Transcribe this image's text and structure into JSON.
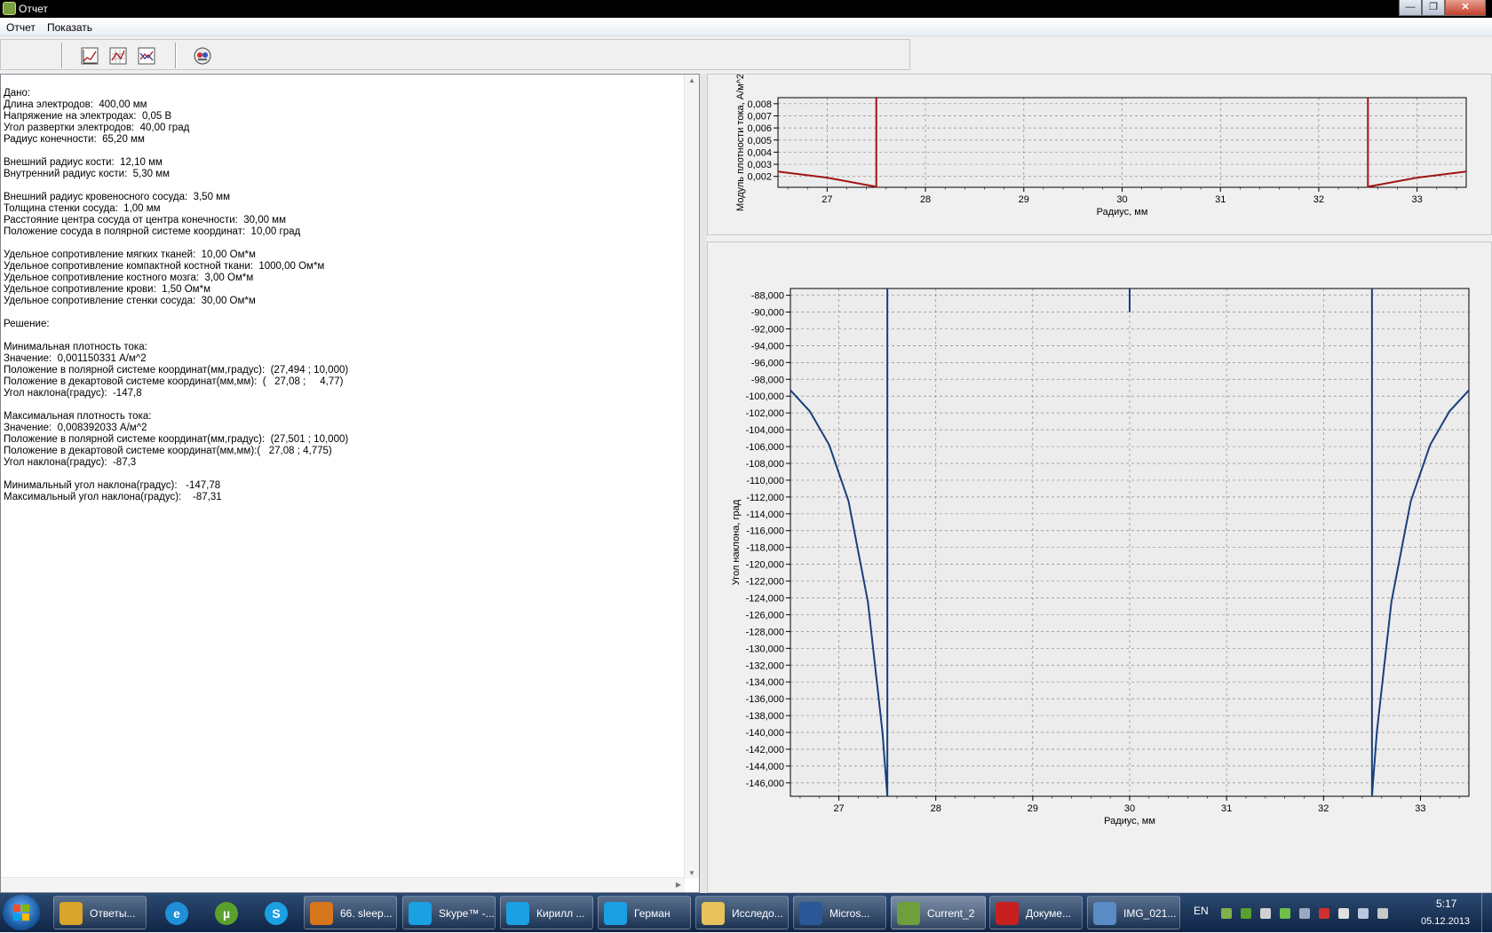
{
  "window": {
    "title": "Отчет",
    "buttons": [
      "—",
      "❐",
      "✕"
    ]
  },
  "menu": [
    "Отчет",
    "Показать"
  ],
  "report_lines": [
    "Дано:",
    "Длина электродов:  400,00 мм",
    "Напряжение на электродах:  0,05 В",
    "Угол развертки электродов:  40,00 град",
    "Радиус конечности:  65,20 мм",
    "",
    "Внешний радиус кости:  12,10 мм",
    "Внутренний радиус кости:  5,30 мм",
    "",
    "Внешний радиус кровеносного сосуда:  3,50 мм",
    "Толщина стенки сосуда:  1,00 мм",
    "Расстояние центра сосуда от центра конечности:  30,00 мм",
    "Положение сосуда в полярной системе координат:  10,00 град",
    "",
    "Удельное сопротивление мягких тканей:  10,00 Ом*м",
    "Удельное сопротивление компактной костной ткани:  1000,00 Ом*м",
    "Удельное сопротивление костного мозга:  3,00 Ом*м",
    "Удельное сопротивление крови:  1,50 Ом*м",
    "Удельное сопротивление стенки сосуда:  30,00 Ом*м",
    "",
    "Решение:",
    "",
    "Минимальная плотность тока:",
    "Значение:  0,001150331 А/м^2",
    "Положение в полярной системе координат(мм,градус):  (27,494 ; 10,000)",
    "Положение в декартовой системе координат(мм,мм):  (   27,08 ;     4,77)",
    "Угол наклона(градус):  -147,8",
    "",
    "Максимальная плотность тока:",
    "Значение:  0,008392033 А/м^2",
    "Положение в полярной системе координат(мм,градус):  (27,501 ; 10,000)",
    "Положение в декартовой системе координат(мм,мм):(   27,08 ; 4,775)",
    "Угол наклона(градус):  -87,3",
    "",
    "Минимальный угол наклона(градус):   -147,78",
    "Максимальный угол наклона(градус):    -87,31"
  ],
  "chart_data": [
    {
      "type": "line",
      "xlabel": "Радиус, мм",
      "ylabel": "Модуль плотности тока, А/м^2",
      "xlim": [
        26.5,
        33.5
      ],
      "ylim": [
        0.0011,
        0.0085
      ],
      "x_ticks": [
        "27",
        "28",
        "29",
        "30",
        "31",
        "32",
        "33"
      ],
      "y_ticks": [
        "0,008",
        "0,007",
        "0,006",
        "0,005",
        "0,004",
        "0,003",
        "0,002"
      ],
      "y_tick_values": [
        0.008,
        0.007,
        0.006,
        0.005,
        0.004,
        0.003,
        0.002
      ],
      "grid": true,
      "color": "#a01414",
      "series": [
        {
          "x": [
            26.5,
            27.0,
            27.5,
            27.5001,
            27.5001,
            27.5
          ],
          "y": [
            0.0024,
            0.0019,
            0.00115,
            0.00115,
            0.0085,
            0.0085
          ]
        },
        {
          "x": [
            32.5,
            32.5,
            32.5001,
            32.5001,
            33.0,
            33.5
          ],
          "y": [
            0.0085,
            0.00115,
            0.00115,
            0.00115,
            0.0019,
            0.0024
          ]
        }
      ]
    },
    {
      "type": "line",
      "xlabel": "Радиус, мм",
      "ylabel": "Угол наклона, град",
      "xlim": [
        26.5,
        33.5
      ],
      "ylim": [
        -147.6,
        -87.2
      ],
      "x_ticks": [
        "27",
        "28",
        "29",
        "30",
        "31",
        "32",
        "33"
      ],
      "y_ticks": [
        "-88,000",
        "-90,000",
        "-92,000",
        "-94,000",
        "-96,000",
        "-98,000",
        "-100,000",
        "-102,000",
        "-104,000",
        "-106,000",
        "-108,000",
        "-110,000",
        "-112,000",
        "-114,000",
        "-116,000",
        "-118,000",
        "-120,000",
        "-122,000",
        "-124,000",
        "-126,000",
        "-128,000",
        "-130,000",
        "-132,000",
        "-134,000",
        "-136,000",
        "-138,000",
        "-140,000",
        "-142,000",
        "-144,000",
        "-146,000"
      ],
      "y_tick_values": [
        -88,
        -90,
        -92,
        -94,
        -96,
        -98,
        -100,
        -102,
        -104,
        -106,
        -108,
        -110,
        -112,
        -114,
        -116,
        -118,
        -120,
        -122,
        -124,
        -126,
        -128,
        -130,
        -132,
        -134,
        -136,
        -138,
        -140,
        -142,
        -144,
        -146
      ],
      "grid": true,
      "color": "#1a3f7a",
      "series": [
        {
          "x": [
            26.5,
            26.7,
            26.9,
            27.1,
            27.3,
            27.45,
            27.5,
            27.5,
            27.5
          ],
          "y": [
            -99.3,
            -101.8,
            -105.8,
            -112.5,
            -124.5,
            -140.0,
            -147.6,
            -87.2,
            -147.6
          ]
        },
        {
          "x": [
            30.0,
            30.0
          ],
          "y": [
            -87.2,
            -90.0
          ]
        },
        {
          "x": [
            32.5,
            32.5,
            32.5,
            32.55,
            32.7,
            32.9,
            33.1,
            33.3,
            33.5
          ],
          "y": [
            -147.6,
            -87.2,
            -147.6,
            -140.0,
            -124.5,
            -112.5,
            -105.8,
            -101.8,
            -99.3
          ]
        }
      ]
    }
  ],
  "taskbar": {
    "pinned": [
      "chrome-icon",
      "ie-icon",
      "utorrent-icon",
      "skype-icon"
    ],
    "items": [
      {
        "label": "Ответы...",
        "icon": "chrome-icon",
        "color": "#d9a52b"
      },
      {
        "label": "66. sleep...",
        "icon": "winamp-icon",
        "color": "#d6761d"
      },
      {
        "label": "Skype™ -...",
        "icon": "skype-icon",
        "color": "#1ba0e2"
      },
      {
        "label": "Кирилл ...",
        "icon": "chat-icon",
        "color": "#1ba0e2"
      },
      {
        "label": "Герман",
        "icon": "chat-icon",
        "color": "#1ba0e2"
      },
      {
        "label": "Исследо...",
        "icon": "folder-icon",
        "color": "#e8c25a"
      },
      {
        "label": "Micros...",
        "icon": "word-icon",
        "color": "#2b5797"
      },
      {
        "label": "Current_2",
        "icon": "app-icon",
        "color": "#6d9f3b"
      },
      {
        "label": "Докуме...",
        "icon": "pdf-icon",
        "color": "#c8201e"
      },
      {
        "label": "IMG_021...",
        "icon": "image-icon",
        "color": "#5a8bc4"
      }
    ],
    "lang": "EN",
    "time": "5:17",
    "date": "05.12.2013"
  }
}
